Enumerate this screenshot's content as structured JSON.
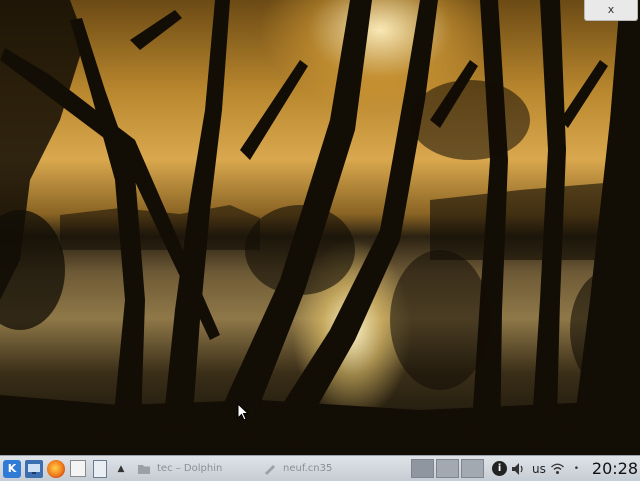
{
  "window": {
    "close_label": "x"
  },
  "taskbar": {
    "launcher_glyph": "K",
    "tasks": [
      {
        "label": "tec – Dolphin",
        "icon": "folder-icon"
      },
      {
        "label": "neuf.cn35",
        "icon": "pen-icon"
      }
    ],
    "pager_count": 3,
    "tray": {
      "info_glyph": "i",
      "keyboard_layout": "us",
      "time": "20:28"
    }
  },
  "colors": {
    "panel_top": "#dfe3e8",
    "panel_bottom": "#c6ccd3",
    "sunset_gold": "#d9a84e",
    "launcher_blue": "#2f7bd6"
  }
}
